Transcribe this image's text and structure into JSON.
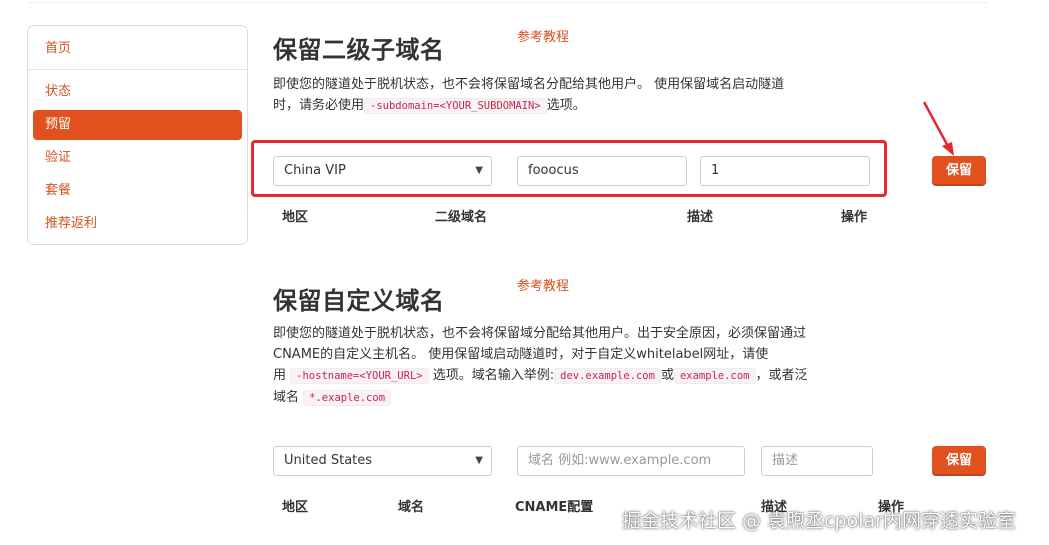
{
  "sidebar": {
    "items": [
      {
        "label": "首页"
      },
      {
        "label": "状态"
      },
      {
        "label": "预留",
        "active": true
      },
      {
        "label": "验证"
      },
      {
        "label": "套餐"
      },
      {
        "label": "推荐返利"
      }
    ]
  },
  "subdomain_section": {
    "title": "保留二级子域名",
    "tutorial_link": "参考教程",
    "desc_line1": "即使您的隧道处于脱机状态，也不会将保留域名分配给其他用户。 使用保留域名启动隧道",
    "desc_line2_prefix": "时，请务必使用",
    "desc_code": "-subdomain=<YOUR_SUBDOMAIN>",
    "desc_line2_suffix": "选项。",
    "region_value": "China VIP",
    "subdomain_value": "fooocus",
    "description_value": "1",
    "reserve_button": "保留",
    "columns": [
      "地区",
      "二级域名",
      "描述",
      "操作"
    ]
  },
  "custom_section": {
    "title": "保留自定义域名",
    "tutorial_link": "参考教程",
    "line1": "即使您的隧道处于脱机状态，也不会将保留域分配给其他用户。出于安全原因，必须保留通过",
    "line2": "CNAME的自定义主机名。 使用保留域启动隧道时，对于自定义whitelabel网址，请使",
    "line3_prefix": "用",
    "line3_code1": "-hostname=<YOUR_URL>",
    "line3_mid": "选项。域名输入举例:",
    "line3_code2": "dev.example.com",
    "line3_or": "或",
    "line3_code3": "example.com",
    "line3_suffix": "，或者泛",
    "line4_prefix": "域名",
    "line4_code": "*.exaple.com",
    "region_value": "United States",
    "domain_placeholder": "域名 例如:www.example.com",
    "description_placeholder": "描述",
    "reserve_button": "保留",
    "columns": [
      "地区",
      "域名",
      "CNAME配置",
      "描述",
      "操作"
    ]
  },
  "watermark": "掘金技术社区 @ 袁煦丞cpolar内网穿透实验室",
  "colors": {
    "accent": "#e0511e",
    "link": "#d2531e",
    "highlight": "#e8262c"
  }
}
